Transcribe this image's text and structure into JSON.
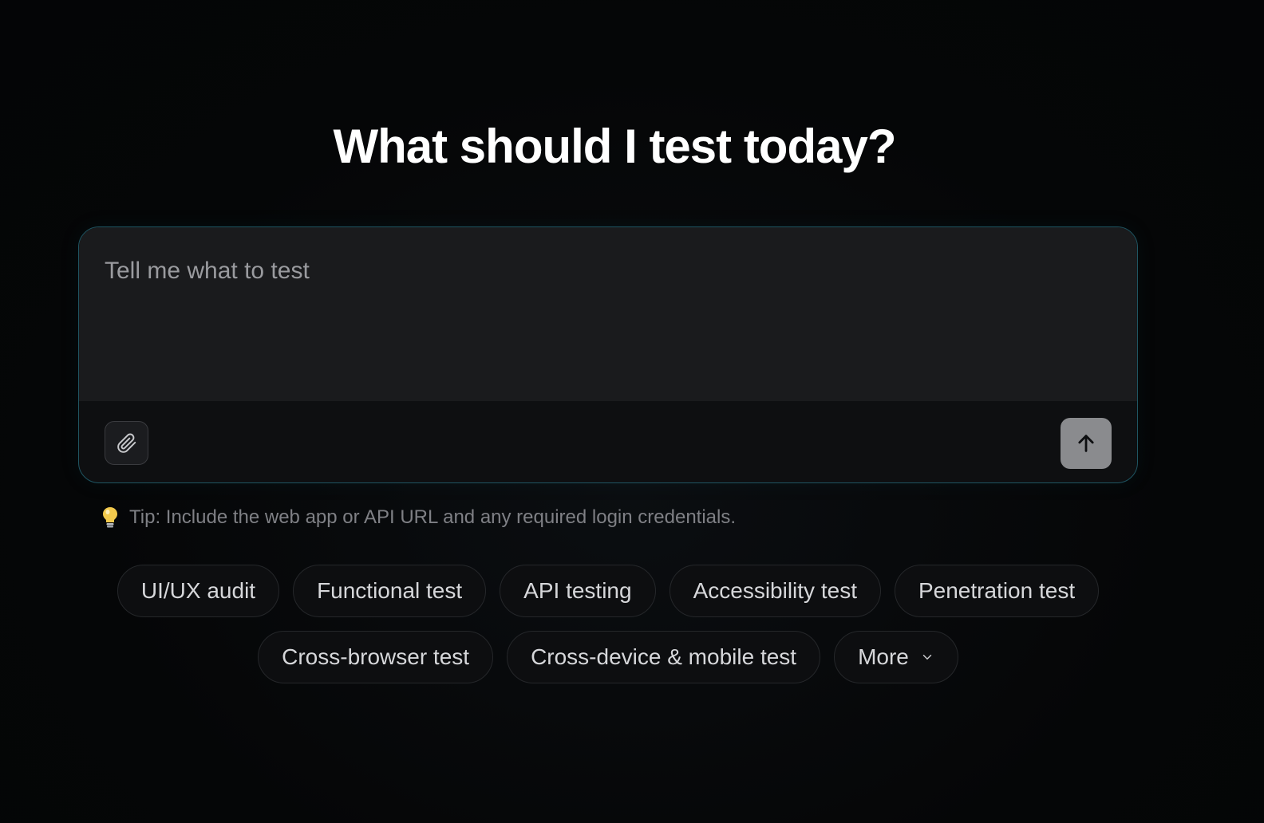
{
  "heading": "What should I test today?",
  "composer": {
    "placeholder": "Tell me what to test",
    "attach_icon": "paperclip-icon",
    "send_icon": "arrow-up-icon"
  },
  "tip": {
    "icon": "lightbulb-icon",
    "text": "Tip: Include the web app or API URL and any required login credentials."
  },
  "suggestions": {
    "row1": [
      "UI/UX audit",
      "Functional test",
      "API testing",
      "Accessibility test",
      "Penetration test"
    ],
    "row2": [
      "Cross-browser test",
      "Cross-device & mobile test"
    ],
    "more_label": "More"
  },
  "colors": {
    "background": "#050607",
    "composer_border": "#1f5562",
    "send_button": "#8a8b8e",
    "tip_icon": "#f2c94c"
  }
}
